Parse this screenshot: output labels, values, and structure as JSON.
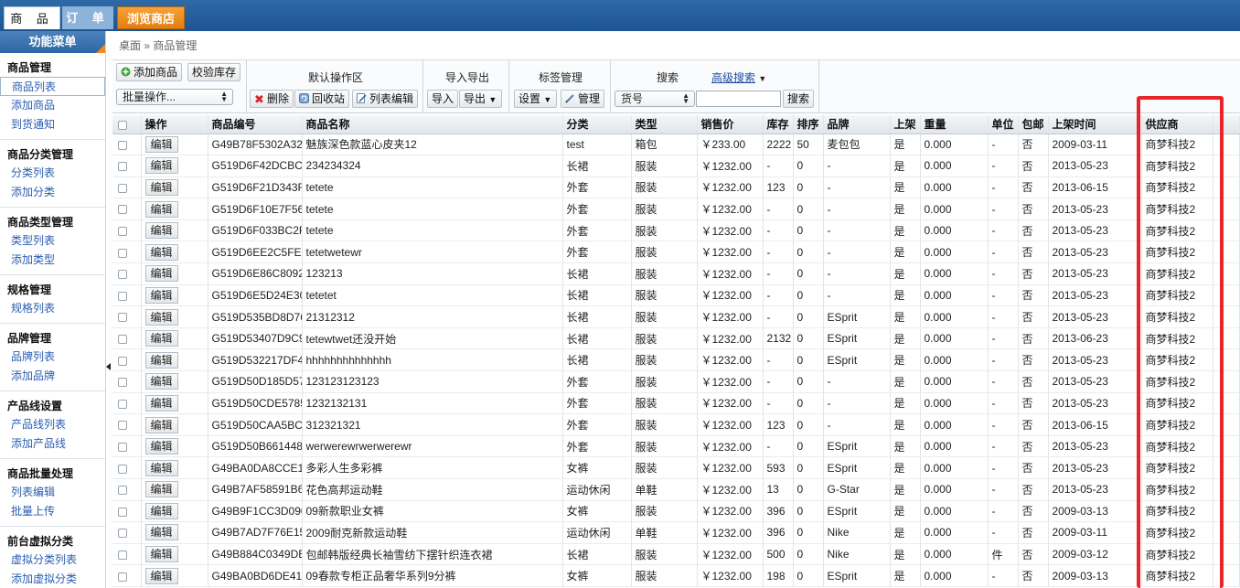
{
  "top_tabs": {
    "goods": "商 品",
    "orders": "订 单",
    "browse": "浏览商店"
  },
  "sidebar": {
    "title": "功能菜单",
    "groups": [
      {
        "title": "商品管理",
        "items": [
          "商品列表",
          "添加商品",
          "到货通知"
        ]
      },
      {
        "title": "商品分类管理",
        "items": [
          "分类列表",
          "添加分类"
        ]
      },
      {
        "title": "商品类型管理",
        "items": [
          "类型列表",
          "添加类型"
        ]
      },
      {
        "title": "规格管理",
        "items": [
          "规格列表"
        ]
      },
      {
        "title": "品牌管理",
        "items": [
          "品牌列表",
          "添加品牌"
        ]
      },
      {
        "title": "产品线设置",
        "items": [
          "产品线列表",
          "添加产品线"
        ]
      },
      {
        "title": "商品批量处理",
        "items": [
          "列表编辑",
          "批量上传"
        ]
      },
      {
        "title": "前台虚拟分类",
        "items": [
          "虚拟分类列表",
          "添加虚拟分类"
        ]
      }
    ]
  },
  "breadcrumb": "桌面 » 商品管理",
  "toolbar": {
    "add_goods": "添加商品",
    "check_stock": "校验库存",
    "batch_ops": "批量操作...",
    "default_area": "默认操作区",
    "delete": "删除",
    "recycle": "回收站",
    "list_edit": "列表编辑",
    "import_export": "导入导出",
    "import": "导入",
    "export": "导出",
    "tag_manage": "标签管理",
    "settings": "设置",
    "manage": "管理",
    "search_title": "搜索",
    "advanced_search": "高级搜索",
    "search_field": "货号",
    "search_value": "",
    "search_btn": "搜索"
  },
  "table": {
    "headers": [
      "操作",
      "商品编号",
      "商品名称",
      "分类",
      "类型",
      "销售价",
      "库存",
      "排序",
      "品牌",
      "上架",
      "重量",
      "单位",
      "包邮",
      "上架时间",
      "供应商"
    ],
    "edit_label": "编辑",
    "rows": [
      [
        "G49B78F5302A32",
        "魅族深色款蓝心皮夹12",
        "test",
        "箱包",
        "￥233.00",
        "2222",
        "50",
        "麦包包",
        "是",
        "0.000",
        "-",
        "否",
        "2009-03-11",
        "商梦科技2"
      ],
      [
        "G519D6F42DCBC4",
        "234234324",
        "长裙",
        "服装",
        "￥1232.00",
        "-",
        "0",
        "-",
        "是",
        "0.000",
        "-",
        "否",
        "2013-05-23",
        "商梦科技2"
      ],
      [
        "G519D6F21D343F",
        "tetete",
        "外套",
        "服装",
        "￥1232.00",
        "123",
        "0",
        "-",
        "是",
        "0.000",
        "-",
        "否",
        "2013-06-15",
        "商梦科技2"
      ],
      [
        "G519D6F10E7F56",
        "tetete",
        "外套",
        "服装",
        "￥1232.00",
        "-",
        "0",
        "-",
        "是",
        "0.000",
        "-",
        "否",
        "2013-05-23",
        "商梦科技2"
      ],
      [
        "G519D6F033BC2F",
        "tetete",
        "外套",
        "服装",
        "￥1232.00",
        "-",
        "0",
        "-",
        "是",
        "0.000",
        "-",
        "否",
        "2013-05-23",
        "商梦科技2"
      ],
      [
        "G519D6EE2C5FE0",
        "tetetwetewr",
        "外套",
        "服装",
        "￥1232.00",
        "-",
        "0",
        "-",
        "是",
        "0.000",
        "-",
        "否",
        "2013-05-23",
        "商梦科技2"
      ],
      [
        "G519D6E86C8092",
        "123213",
        "长裙",
        "服装",
        "￥1232.00",
        "-",
        "0",
        "-",
        "是",
        "0.000",
        "-",
        "否",
        "2013-05-23",
        "商梦科技2"
      ],
      [
        "G519D6E5D24E30",
        "tetetet",
        "长裙",
        "服装",
        "￥1232.00",
        "-",
        "0",
        "-",
        "是",
        "0.000",
        "-",
        "否",
        "2013-05-23",
        "商梦科技2"
      ],
      [
        "G519D535BD8D76",
        "21312312",
        "长裙",
        "服装",
        "￥1232.00",
        "-",
        "0",
        "ESprit",
        "是",
        "0.000",
        "-",
        "否",
        "2013-05-23",
        "商梦科技2"
      ],
      [
        "G519D53407D9C9",
        "tetewtwet还没开始",
        "长裙",
        "服装",
        "￥1232.00",
        "2132",
        "0",
        "ESprit",
        "是",
        "0.000",
        "-",
        "否",
        "2013-06-23",
        "商梦科技2"
      ],
      [
        "G519D532217DF4",
        "hhhhhhhhhhhhhh",
        "长裙",
        "服装",
        "￥1232.00",
        "-",
        "0",
        "ESprit",
        "是",
        "0.000",
        "-",
        "否",
        "2013-05-23",
        "商梦科技2"
      ],
      [
        "G519D50D185D57",
        "123123123123",
        "外套",
        "服装",
        "￥1232.00",
        "-",
        "0",
        "-",
        "是",
        "0.000",
        "-",
        "否",
        "2013-05-23",
        "商梦科技2"
      ],
      [
        "G519D50CDE5785",
        "1232132131",
        "外套",
        "服装",
        "￥1232.00",
        "-",
        "0",
        "-",
        "是",
        "0.000",
        "-",
        "否",
        "2013-05-23",
        "商梦科技2"
      ],
      [
        "G519D50CAA5BC",
        "312321321",
        "外套",
        "服装",
        "￥1232.00",
        "123",
        "0",
        "-",
        "是",
        "0.000",
        "-",
        "否",
        "2013-06-15",
        "商梦科技2"
      ],
      [
        "G519D50B661448",
        "werwerewrwerwerewr",
        "外套",
        "服装",
        "￥1232.00",
        "-",
        "0",
        "ESprit",
        "是",
        "0.000",
        "-",
        "否",
        "2013-05-23",
        "商梦科技2"
      ],
      [
        "G49BA0DA8CCE1",
        "多彩人生多彩裤",
        "女裤",
        "服装",
        "￥1232.00",
        "593",
        "0",
        "ESprit",
        "是",
        "0.000",
        "-",
        "否",
        "2013-05-23",
        "商梦科技2"
      ],
      [
        "G49B7AF58591B6",
        "花色高邦运动鞋",
        "运动休闲",
        "单鞋",
        "￥1232.00",
        "13",
        "0",
        "G-Star",
        "是",
        "0.000",
        "-",
        "否",
        "2013-05-23",
        "商梦科技2"
      ],
      [
        "G49B9F1CC3D090",
        "09新款职业女裤",
        "女裤",
        "服装",
        "￥1232.00",
        "396",
        "0",
        "ESprit",
        "是",
        "0.000",
        "-",
        "否",
        "2009-03-13",
        "商梦科技2"
      ],
      [
        "G49B7AD7F76E15",
        "2009耐克新款运动鞋",
        "运动休闲",
        "单鞋",
        "￥1232.00",
        "396",
        "0",
        "Nike",
        "是",
        "0.000",
        "-",
        "否",
        "2009-03-11",
        "商梦科技2"
      ],
      [
        "G49B884C0349DE",
        "包邮韩版经典长袖雪纺下摆针织连衣裙",
        "长裙",
        "服装",
        "￥1232.00",
        "500",
        "0",
        "Nike",
        "是",
        "0.000",
        "件",
        "否",
        "2009-03-12",
        "商梦科技2"
      ],
      [
        "G49BA0BD6DE41",
        "09春款专柜正品奢华系列9分裤",
        "女裤",
        "服装",
        "￥1232.00",
        "198",
        "0",
        "ESprit",
        "是",
        "0.000",
        "-",
        "否",
        "2009-03-13",
        "商梦科技2"
      ]
    ]
  }
}
